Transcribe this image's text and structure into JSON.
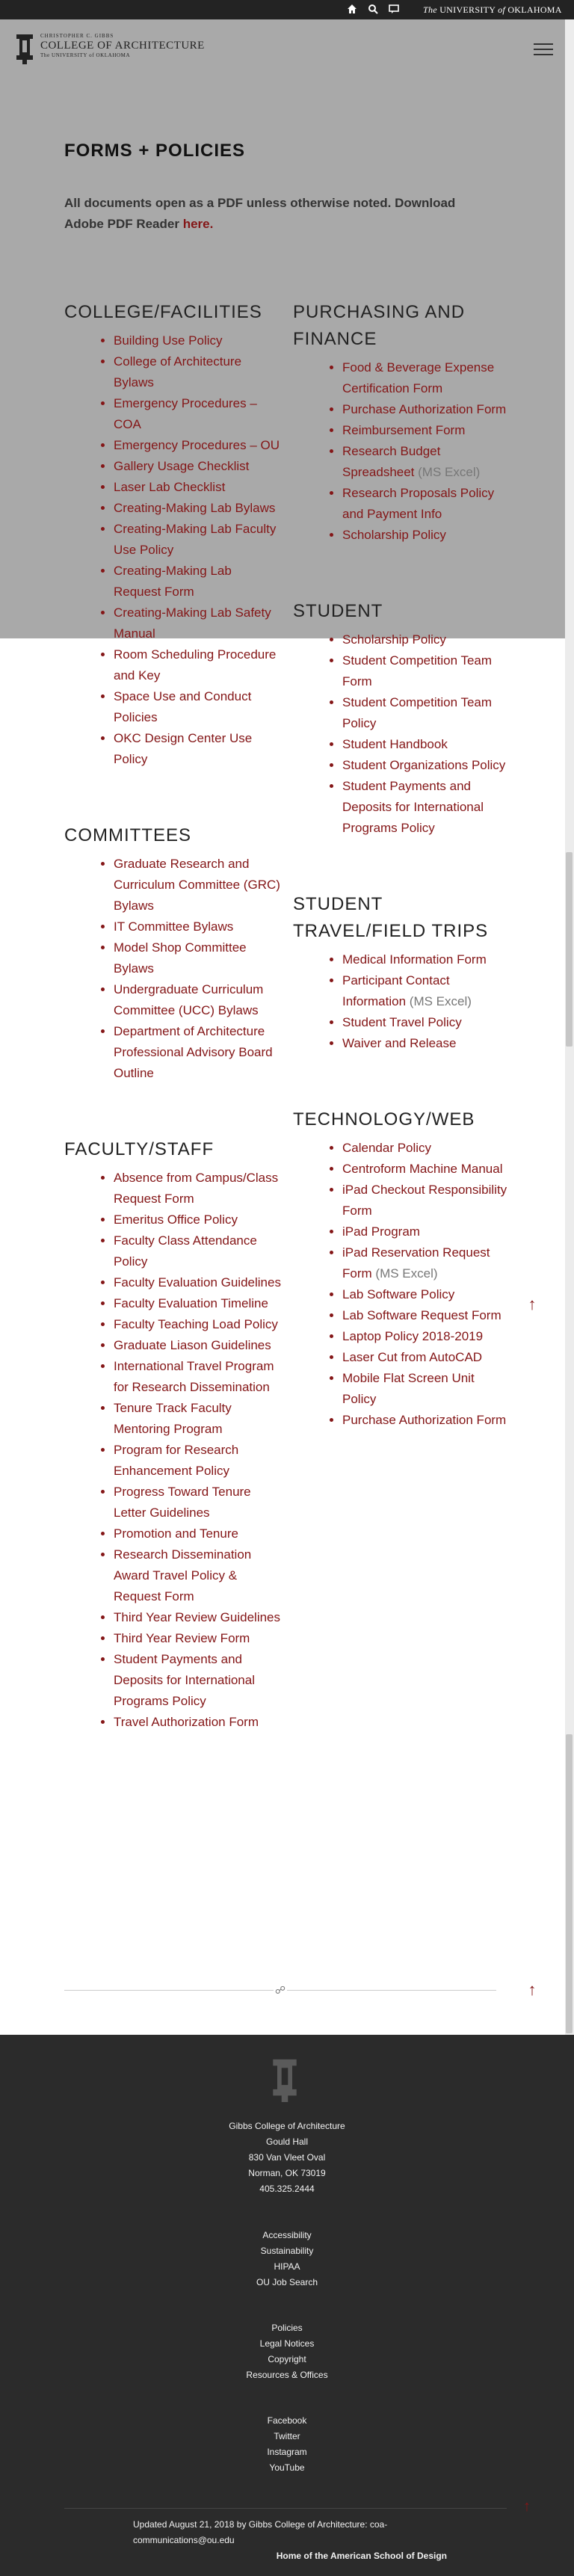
{
  "topbar": {
    "icons": [
      "home-icon",
      "search-icon",
      "chat-icon"
    ],
    "univ_prefix": "The",
    "univ_name": "UNIVERSITY",
    "univ_of": "of",
    "univ_state": "OKLAHOMA"
  },
  "logo": {
    "line1": "CHRISTOPHER C. GIBBS",
    "line2": "COLLEGE OF ARCHITECTURE",
    "line3": "The UNIVERSITY of OKLAHOMA"
  },
  "page": {
    "title": "FORMS + POLICIES",
    "intro": "All documents open as a PDF unless otherwise noted. Download Adobe PDF Reader",
    "intro_link": "here."
  },
  "sections": {
    "college": {
      "heading": "COLLEGE/FACILITIES",
      "items": [
        "Building Use Policy",
        "College of Architecture Bylaws",
        "Emergency Procedures – COA",
        "Emergency Procedures – OU",
        "Gallery Usage Checklist",
        "Laser Lab Checklist",
        "Creating-Making Lab Bylaws",
        "Creating-Making Lab Faculty Use Policy",
        "Creating-Making Lab Request Form",
        "Creating-Making Lab Safety Manual",
        "Room Scheduling Procedure and Key",
        "Space Use and Conduct Policies",
        "OKC Design Center Use Policy"
      ]
    },
    "committees": {
      "heading": "COMMITTEES",
      "items": [
        "Graduate Research and Curriculum Committee (GRC) Bylaws",
        "IT Committee Bylaws",
        "Model Shop Committee Bylaws",
        "Undergraduate Curriculum Committee (UCC) Bylaws",
        "Department of Architecture Professional Advisory Board Outline"
      ]
    },
    "faculty": {
      "heading": "FACULTY/STAFF",
      "items": [
        "Absence from Campus/Class Request Form",
        "Emeritus Office Policy",
        "Faculty Class Attendance Policy",
        "Faculty Evaluation Guidelines",
        "Faculty Evaluation Timeline",
        "Faculty Teaching Load Policy",
        "Graduate Liason Guidelines",
        "International Travel Program for Research Dissemination",
        "Tenure Track Faculty Mentoring Program",
        "Program for Research Enhancement Policy",
        "Progress Toward Tenure Letter Guidelines",
        "Promotion and Tenure",
        "Research Dissemination Award Travel Policy & Request Form",
        "Third Year Review Guidelines",
        "Third Year Review Form",
        "Student Payments and Deposits for International Programs Policy",
        "Travel Authorization Form"
      ]
    },
    "purchasing": {
      "heading": "PURCHASING AND FINANCE",
      "items": [
        {
          "label": "Food & Beverage Expense Certification Form",
          "note": ""
        },
        {
          "label": "Purchase Authorization Form",
          "note": ""
        },
        {
          "label": "Reimbursement Form",
          "note": ""
        },
        {
          "label": "Research Budget Spreadsheet",
          "note": "(MS Excel)"
        },
        {
          "label": "Research Proposals Policy and Payment Info",
          "note": ""
        },
        {
          "label": "Scholarship Policy",
          "note": ""
        }
      ]
    },
    "student": {
      "heading": "STUDENT",
      "items": [
        "Scholarship Policy",
        "Student Competition Team Form",
        "Student Competition Team Policy",
        "Student Handbook",
        "Student Organizations Policy",
        "Student Payments and Deposits for International Programs Policy"
      ]
    },
    "travel": {
      "heading": "STUDENT TRAVEL/FIELD TRIPS",
      "items": [
        {
          "label": "Medical Information Form",
          "note": ""
        },
        {
          "label": "Participant Contact Information",
          "note": "(MS Excel)"
        },
        {
          "label": "Student Travel Policy",
          "note": ""
        },
        {
          "label": "Waiver and Release",
          "note": ""
        }
      ]
    },
    "tech": {
      "heading": "TECHNOLOGY/WEB",
      "items": [
        {
          "label": "Calendar Policy",
          "note": ""
        },
        {
          "label": "Centroform Machine Manual",
          "note": ""
        },
        {
          "label": "iPad Checkout Responsibility Form",
          "note": ""
        },
        {
          "label": "iPad Program",
          "note": ""
        },
        {
          "label": "iPad Reservation Request Form",
          "note": "(MS Excel)"
        },
        {
          "label": "Lab Software Policy",
          "note": ""
        },
        {
          "label": "Lab Software Request Form",
          "note": ""
        },
        {
          "label": "Laptop Policy 2018-2019",
          "note": ""
        },
        {
          "label": "Laser Cut from AutoCAD",
          "note": ""
        },
        {
          "label": "Mobile Flat Screen Unit Policy",
          "note": ""
        },
        {
          "label": "Purchase Authorization Form",
          "note": ""
        }
      ]
    }
  },
  "footer": {
    "address": [
      "Gibbs College of Architecture",
      "Gould Hall",
      "830 Van Vleet Oval",
      "Norman, OK 73019",
      "405.325.2444"
    ],
    "links1": [
      "Accessibility",
      "Sustainability",
      "HIPAA",
      "OU Job Search"
    ],
    "links2": [
      "Policies",
      "Legal Notices",
      "Copyright",
      "Resources & Offices"
    ],
    "social": [
      "Facebook",
      "Twitter",
      "Instagram",
      "YouTube"
    ],
    "updated": "Updated August 21, 2018 by Gibbs College of Architecture: coa-communications@ou.edu",
    "tagline": "Home of the American School of Design"
  },
  "colors": {
    "accent": "#841617",
    "overlay": "#a9a9a9",
    "footer_bg": "#2b2b2b"
  }
}
